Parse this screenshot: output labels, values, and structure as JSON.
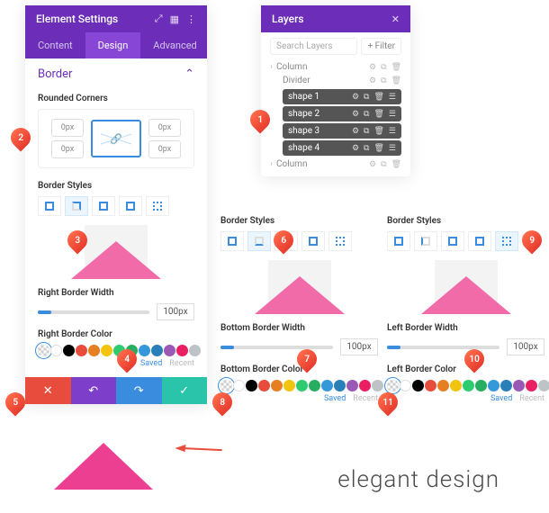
{
  "settings": {
    "title": "Element Settings",
    "tabs": {
      "content": "Content",
      "design": "Design",
      "advanced": "Advanced"
    },
    "section_title": "Border",
    "rounded_label": "Rounded Corners",
    "corner_val": "0px",
    "styles_label": "Border Styles",
    "width_label_right": "Right Border Width",
    "width_label_bottom": "Bottom Border Width",
    "width_label_left": "Left Border Width",
    "width_val": "100px",
    "color_label_right": "Right Border Color",
    "color_label_bottom": "Bottom Border Color",
    "color_label_left": "Left Border Color",
    "saved": "Saved",
    "recent": "Recent"
  },
  "layers": {
    "title": "Layers",
    "search_ph": "Search Layers",
    "filter": "Filter",
    "column": "Column",
    "divider": "Divider",
    "shapes": [
      "shape 1",
      "shape 2",
      "shape 3",
      "shape 4"
    ]
  },
  "swatches": [
    "transp",
    "#ffffff",
    "#000000",
    "#e74c3c",
    "#e67e22",
    "#f1c40f",
    "#2ecc71",
    "#27ae60",
    "#3498db",
    "#2980b9",
    "#9b59b6",
    "#e91e63",
    "#bdc3c7"
  ],
  "badges": [
    "1",
    "2",
    "3",
    "4",
    "5",
    "6",
    "7",
    "8",
    "9",
    "10",
    "11"
  ],
  "footer_text": "elegant design"
}
